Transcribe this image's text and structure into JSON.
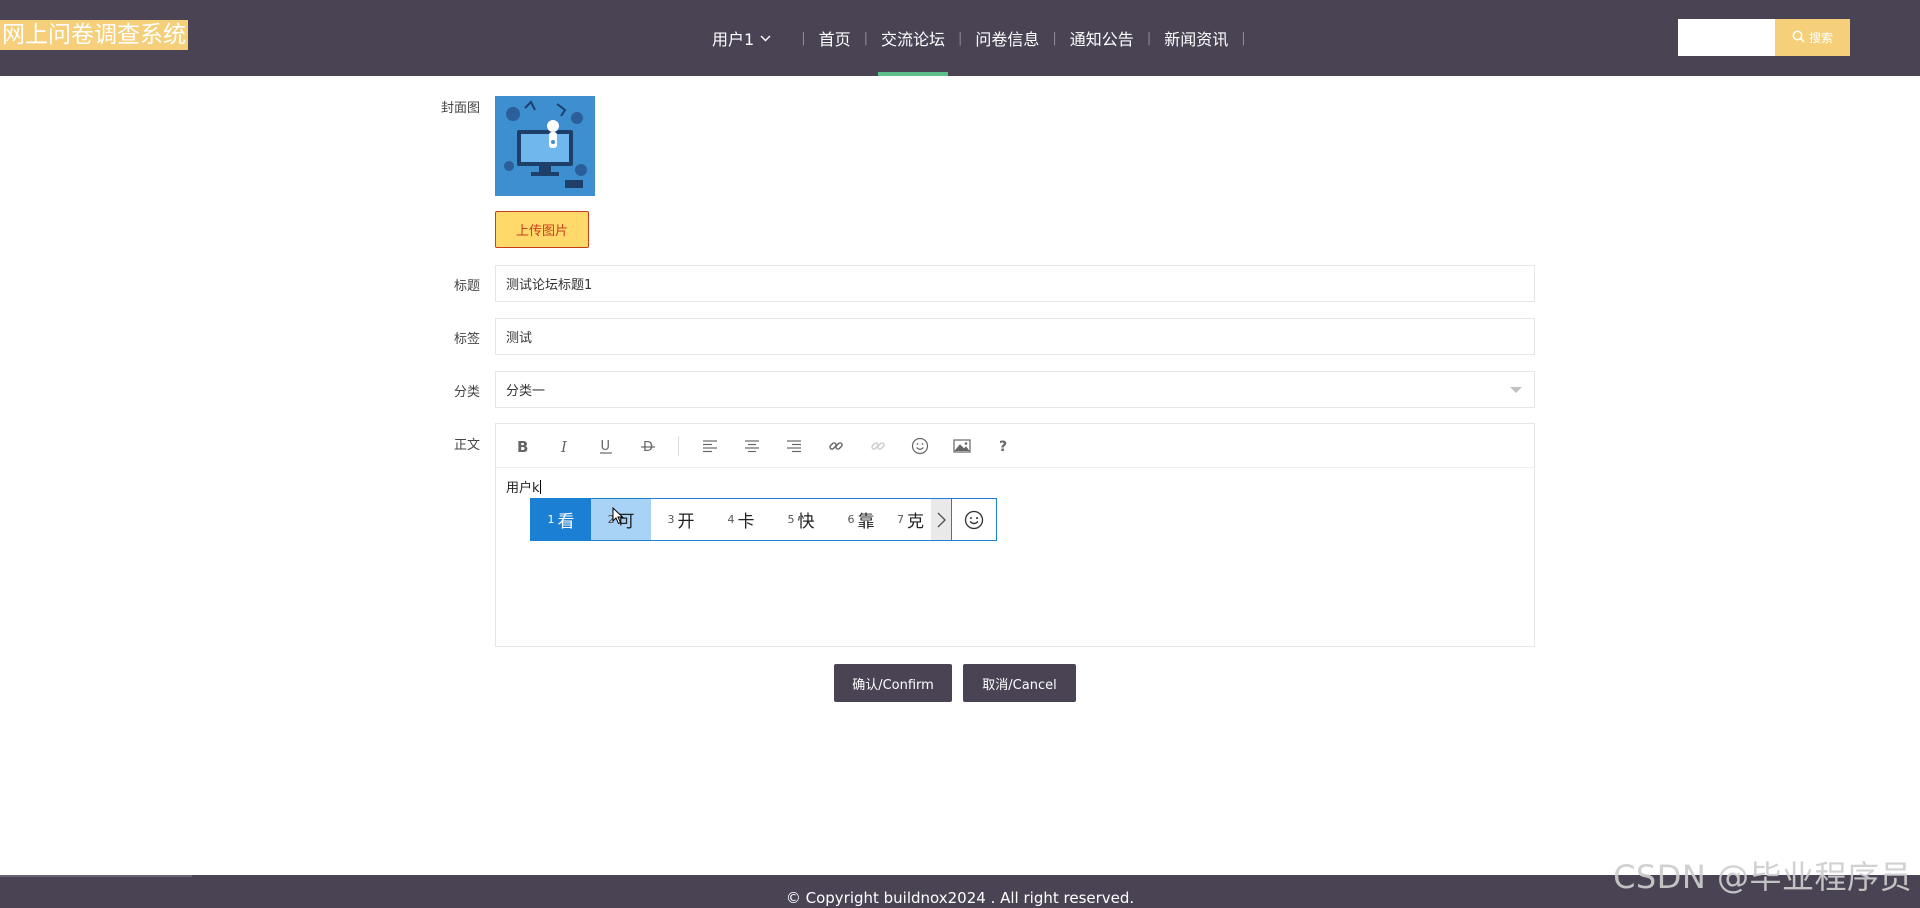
{
  "header": {
    "logo": "网上问卷调查系统",
    "user_menu": "用户1",
    "nav": [
      "首页",
      "交流论坛",
      "问卷信息",
      "通知公告",
      "新闻资讯"
    ],
    "active_nav": "交流论坛",
    "search": {
      "placeholder": "",
      "button": "搜索"
    }
  },
  "form": {
    "cover": {
      "label": "封面图",
      "upload_button": "上传图片"
    },
    "title": {
      "label": "标题",
      "value": "测试论坛标题1"
    },
    "tag": {
      "label": "标签",
      "value": "测试"
    },
    "category": {
      "label": "分类",
      "value": "分类一"
    },
    "content": {
      "label": "正文",
      "text": "用户k"
    },
    "toolbar_icons": [
      "bold-icon",
      "italic-icon",
      "underline-icon",
      "strikethrough-icon",
      "align-left-icon",
      "align-center-icon",
      "align-right-icon",
      "link-icon",
      "unlink-icon",
      "emoji-icon",
      "image-icon",
      "help-icon"
    ]
  },
  "ime": {
    "candidates": [
      {
        "num": "1",
        "char": "看"
      },
      {
        "num": "2",
        "char": "可"
      },
      {
        "num": "3",
        "char": "开"
      },
      {
        "num": "4",
        "char": "卡"
      },
      {
        "num": "5",
        "char": "快"
      },
      {
        "num": "6",
        "char": "靠"
      },
      {
        "num": "7",
        "char": "克"
      }
    ]
  },
  "actions": {
    "confirm": "确认/Confirm",
    "cancel": "取消/Cancel"
  },
  "footer": {
    "copyright": "© Copyright buildnox2024 . All right reserved."
  },
  "watermark": "CSDN @毕业程序员",
  "colors": {
    "header_bg": "#4a4354",
    "accent_yellow": "#f5cf7a",
    "active_underline": "#5fbf8a",
    "ime_blue": "#1b7fd3"
  }
}
